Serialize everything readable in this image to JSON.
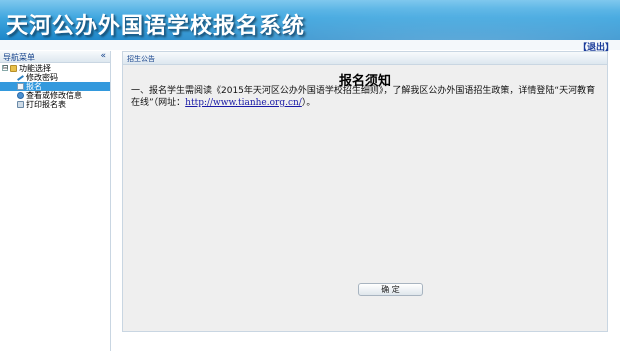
{
  "header": {
    "title": "天河公办外国语学校报名系统",
    "logout_label": "【退出】"
  },
  "sidebar": {
    "title": "导航菜单",
    "collapse_icon": "double-chevron-left-icon",
    "root": {
      "label": "功能选择",
      "toggle": "⊟",
      "icon": "folder-icon"
    },
    "items": [
      {
        "label": "修改密码",
        "icon": "key-icon",
        "selected": false
      },
      {
        "label": "报名",
        "icon": "doc-icon",
        "selected": true
      },
      {
        "label": "查看或修改信息",
        "icon": "gear-icon",
        "selected": false
      },
      {
        "label": "打印报名表",
        "icon": "print-icon",
        "selected": false
      }
    ]
  },
  "main": {
    "panel_title": "招生公告",
    "notice_title": "报名须知",
    "notice_prefix": "一、报名学生需阅读《2015年天河区公办外国语学校招生细则》，了解我区公办外国语招生政策，详情登陆“天河教育在线”（网址：",
    "notice_link": "http://www.tianhe.org.cn/",
    "notice_suffix": "）。",
    "confirm_label": "确 定"
  },
  "colors": {
    "header_gradient_top": "#7fc8ee",
    "header_gradient_bottom": "#1d86c9",
    "selected_item_bg": "#3399dd",
    "panel_title_color": "#15428b",
    "link_color": "#1a1aa6"
  }
}
